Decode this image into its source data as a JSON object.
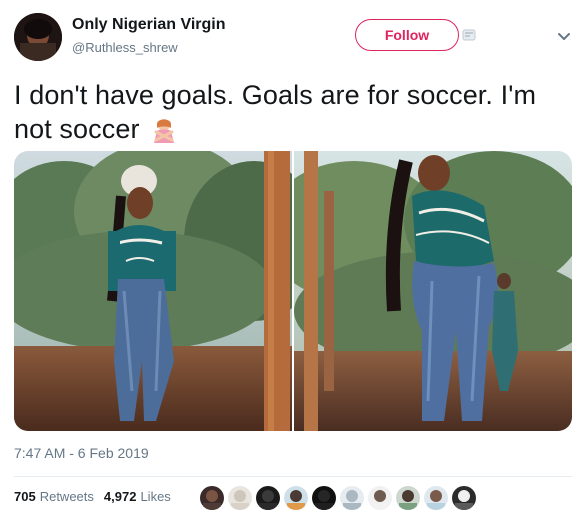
{
  "user": {
    "display_name": "Only Nigerian Virgin",
    "handle": "@Ruthless_shrew"
  },
  "actions": {
    "follow_label": "Follow"
  },
  "tweet": {
    "text": "I don't have goals. Goals are for soccer. I'm not soccer",
    "emoji": "person-gesturing-no-emoji"
  },
  "meta": {
    "timestamp": "7:47 AM - 6 Feb 2019"
  },
  "stats": {
    "retweets_count": "705",
    "retweets_label": "Retweets",
    "likes_count": "4,972",
    "likes_label": "Likes"
  },
  "colors": {
    "follow": "#e0245e",
    "text": "#14171a",
    "muted": "#657786"
  },
  "icons": [
    "chevron-down-icon",
    "small-link-icon",
    "emoji-icon"
  ]
}
